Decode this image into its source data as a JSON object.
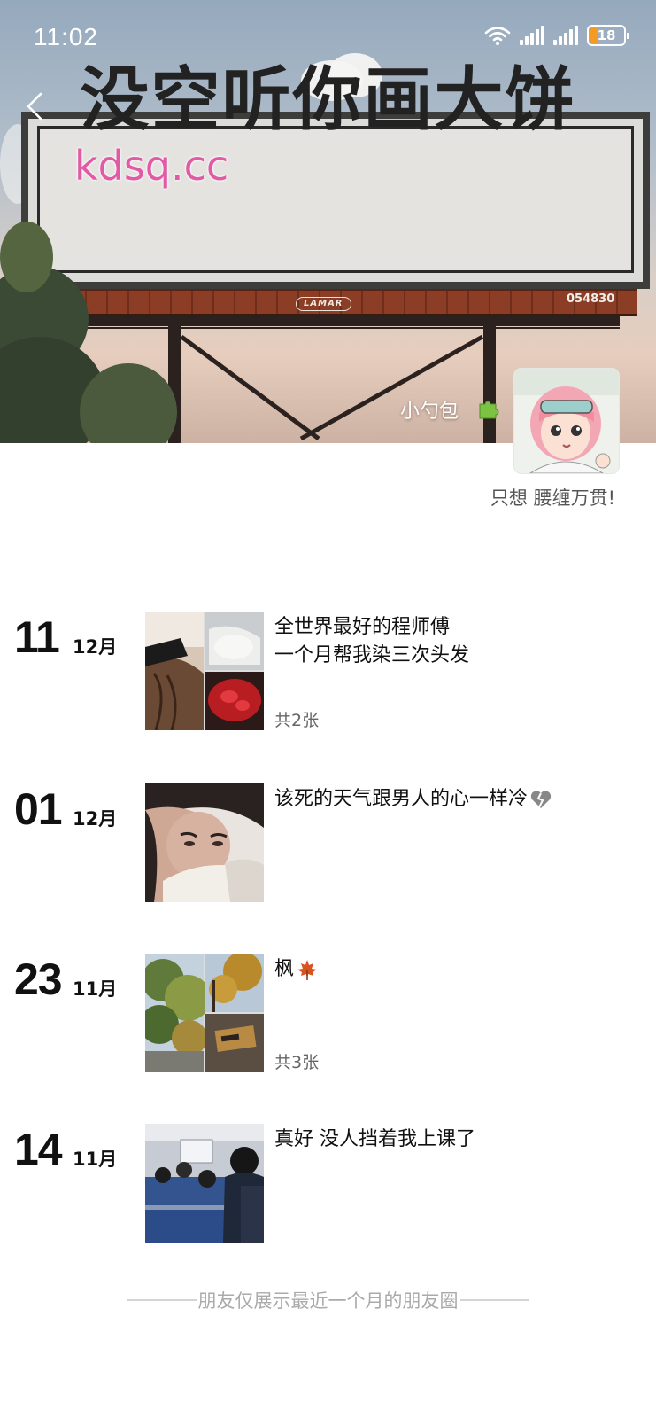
{
  "status_bar": {
    "time": "11:02",
    "battery_level": "18"
  },
  "cover": {
    "billboard_text": "没空听你画大饼",
    "watermark": "kdsq.cc",
    "billboard_brand": "LAMAR",
    "billboard_serial": "054830"
  },
  "profile": {
    "nickname": "小勺包",
    "nickname_icon": "puzzle-icon",
    "signature": "只想 腰缠万贯!"
  },
  "posts": [
    {
      "day": "11",
      "month": "12月",
      "text": "全世界最好的程师傅\n一个月帮我染三次头发",
      "photo_count": "共2张"
    },
    {
      "day": "01",
      "month": "12月",
      "text": "该死的天气跟男人的心一样冷",
      "emoji": "broken-heart-icon"
    },
    {
      "day": "23",
      "month": "11月",
      "text": "枫",
      "emoji": "maple-leaf-icon",
      "photo_count": "共3张"
    },
    {
      "day": "14",
      "month": "11月",
      "text": "真好  没人挡着我上课了"
    }
  ],
  "footer": {
    "notice": "朋友仅展示最近一个月的朋友圈"
  },
  "colors": {
    "accent_battery": "#f59a23",
    "watermark": "#e25aa5"
  }
}
